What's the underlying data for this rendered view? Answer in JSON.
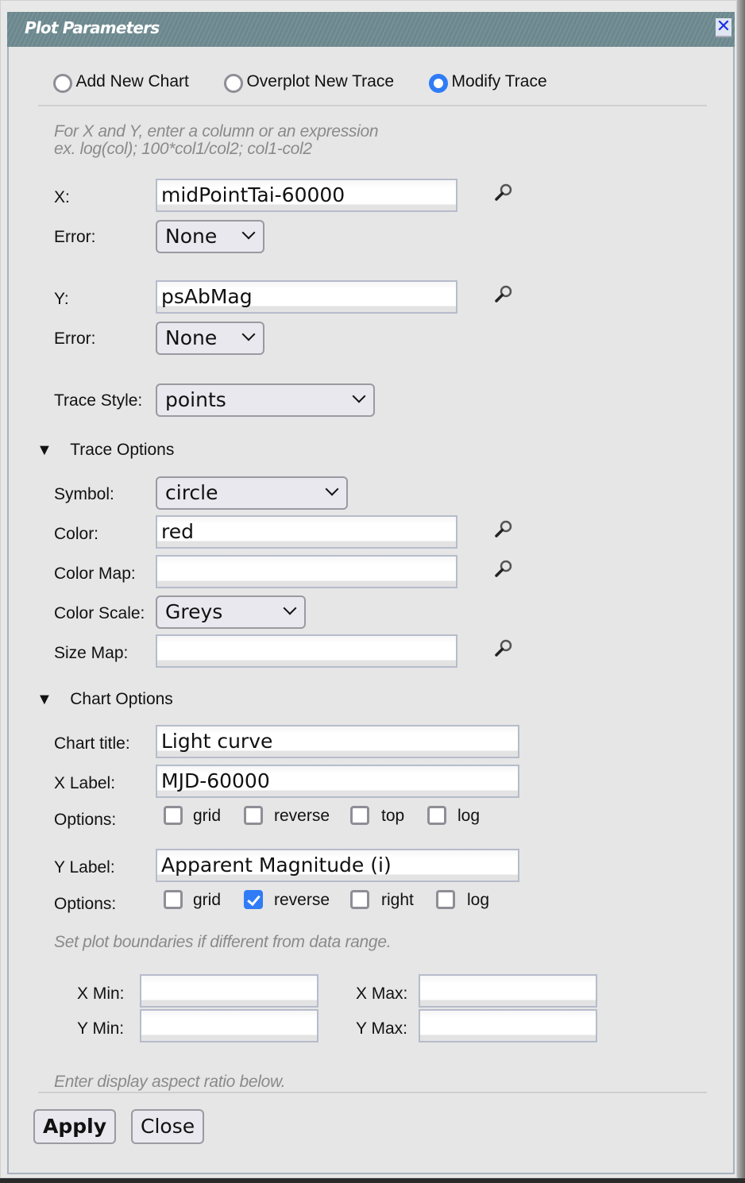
{
  "dialog": {
    "title": "Plot Parameters",
    "close_icon": "close-x-icon"
  },
  "mode": {
    "options": [
      {
        "label": "Add New Chart",
        "selected": false
      },
      {
        "label": "Overplot New Trace",
        "selected": false
      },
      {
        "label": "Modify Trace",
        "selected": true
      }
    ]
  },
  "hint": {
    "line1": "For X and Y, enter a column or an expression",
    "line2": "ex. log(col); 100*col1/col2; col1-col2"
  },
  "x": {
    "label": "X:",
    "value": "midPointTai-60000",
    "error_label": "Error:",
    "error_value": "None"
  },
  "y": {
    "label": "Y:",
    "value": "psAbMag",
    "error_label": "Error:",
    "error_value": "None"
  },
  "trace_style": {
    "label": "Trace Style:",
    "value": "points"
  },
  "trace_options": {
    "heading": "Trace Options",
    "symbol_label": "Symbol:",
    "symbol_value": "circle",
    "color_label": "Color:",
    "color_value": "red",
    "color_map_label": "Color Map:",
    "color_map_value": "",
    "color_scale_label": "Color Scale:",
    "color_scale_value": "Greys",
    "size_map_label": "Size Map:",
    "size_map_value": ""
  },
  "chart_options": {
    "heading": "Chart Options",
    "title_label": "Chart title:",
    "title_value": "Light curve",
    "xlabel_label": "X Label:",
    "xlabel_value": "MJD-60000",
    "x_options_label": "Options:",
    "x_options": [
      {
        "label": "grid",
        "checked": false
      },
      {
        "label": "reverse",
        "checked": false
      },
      {
        "label": "top",
        "checked": false
      },
      {
        "label": "log",
        "checked": false
      }
    ],
    "ylabel_label": "Y Label:",
    "ylabel_value": "Apparent Magnitude (i)",
    "y_options_label": "Options:",
    "y_options": [
      {
        "label": "grid",
        "checked": false
      },
      {
        "label": "reverse",
        "checked": true
      },
      {
        "label": "right",
        "checked": false
      },
      {
        "label": "log",
        "checked": false
      }
    ]
  },
  "bounds": {
    "hint": "Set plot boundaries if different from data range.",
    "xmin_label": "X Min:",
    "xmin_value": "",
    "xmax_label": "X Max:",
    "xmax_value": "",
    "ymin_label": "Y Min:",
    "ymin_value": "",
    "ymax_label": "Y Max:",
    "ymax_value": ""
  },
  "aspect": {
    "hint": "Enter display aspect ratio below."
  },
  "buttons": {
    "apply": "Apply",
    "close": "Close"
  },
  "colors": {
    "accent": "#2f7cf6",
    "titlebar": "#6f8c92",
    "close_icon": "#1a2fe8"
  }
}
